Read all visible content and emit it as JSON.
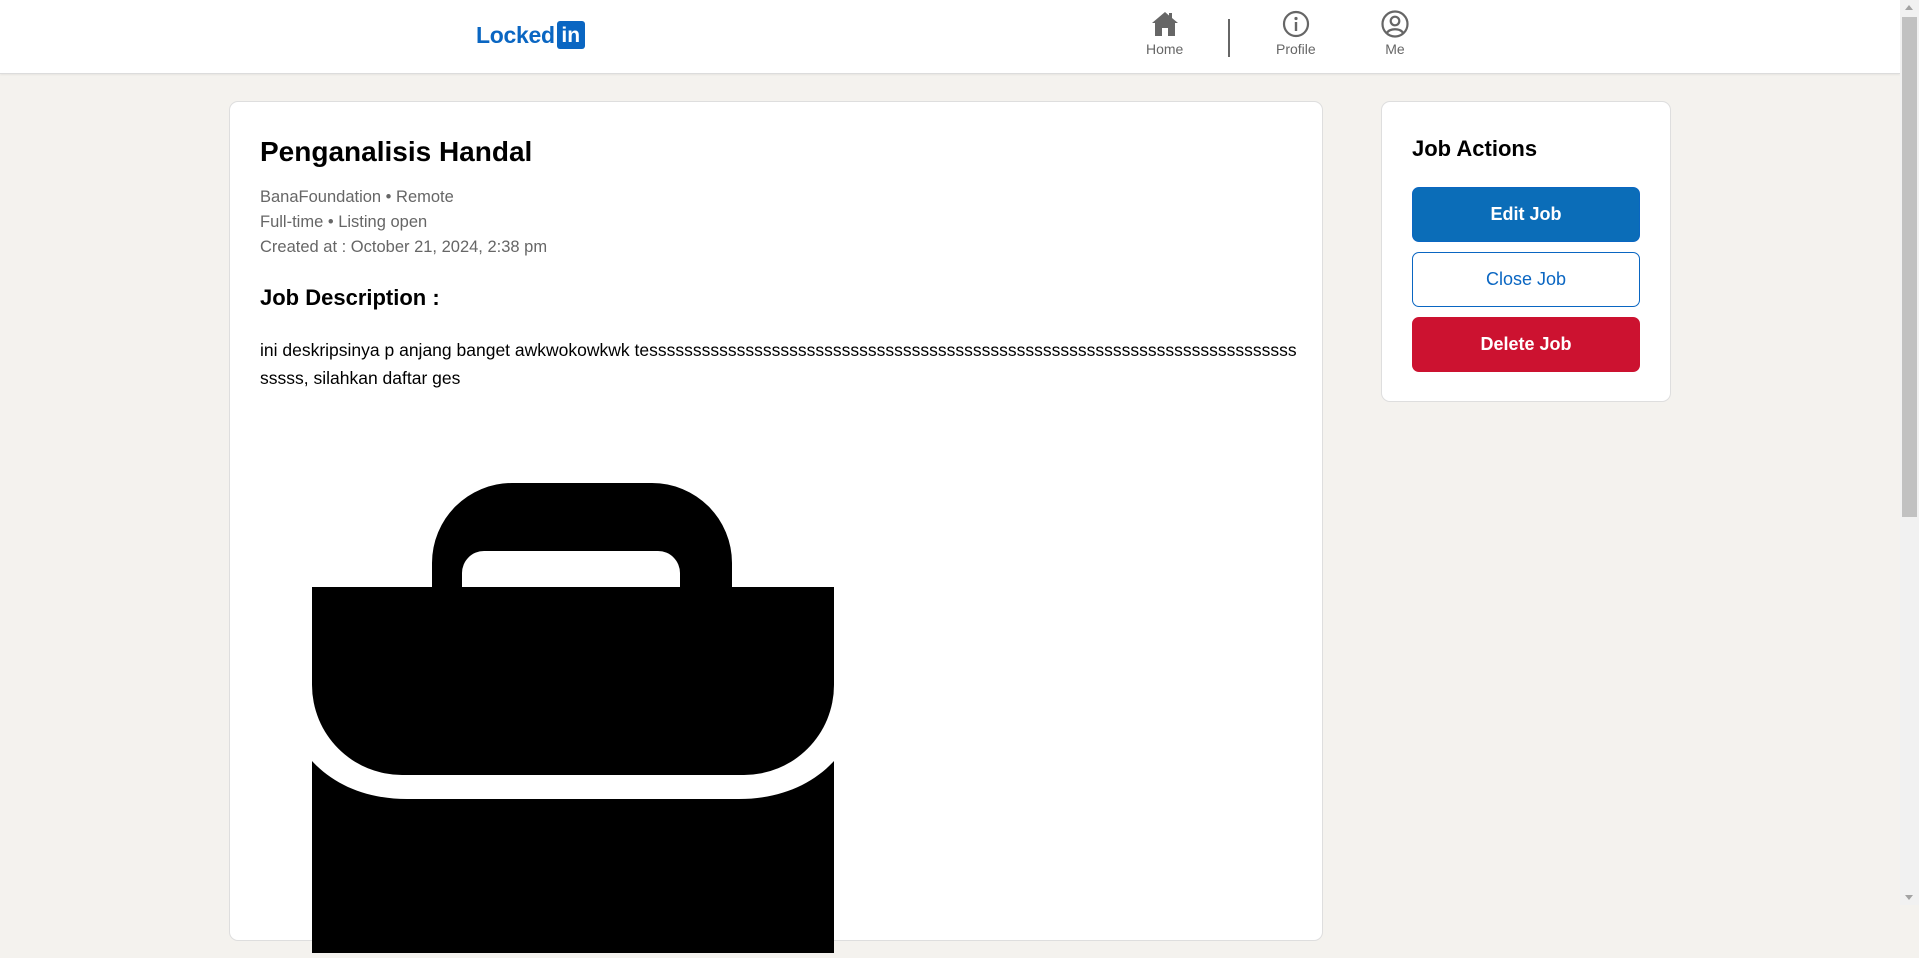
{
  "header": {
    "logo_text": "Locked",
    "logo_box": "in",
    "nav": [
      {
        "label": "Home",
        "icon": "home-icon"
      },
      {
        "label": "Profile",
        "icon": "info-icon"
      },
      {
        "label": "Me",
        "icon": "user-circle-icon"
      }
    ]
  },
  "job": {
    "title": "Penganalisis Handal",
    "company_location": "BanaFoundation • Remote",
    "type_status": "Full-time • Listing open",
    "created_at": "Created at : October 21, 2024, 2:38 pm",
    "description_heading": "Job Description :",
    "description": "ini deskripsinya p anjang banget awkwokowkwk tesssssssssssssssssssssssssssssssssssssssssssssssssssssssssssssssssssssssssssssss, silahkan daftar ges",
    "image_icon": "briefcase-icon"
  },
  "actions": {
    "title": "Job Actions",
    "edit_label": "Edit Job",
    "close_label": "Close Job",
    "delete_label": "Delete Job"
  },
  "colors": {
    "brand": "#0a66c2",
    "danger": "#cc1230",
    "background": "#f4f2ee"
  }
}
